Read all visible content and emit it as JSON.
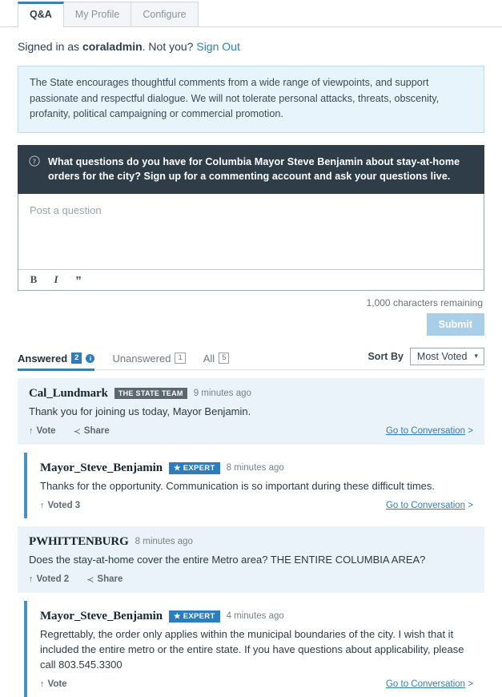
{
  "tabs": [
    {
      "label": "Q&A",
      "active": true
    },
    {
      "label": "My Profile",
      "active": false
    },
    {
      "label": "Configure",
      "active": false
    }
  ],
  "account": {
    "prefix": "Signed in as ",
    "username": "coraladmin",
    "middle": ". Not you? ",
    "signout_label": "Sign Out"
  },
  "notice": {
    "text": "The State encourages thoughtful comments from a wide range of viewpoints, and support passionate and respectful dialogue. We will not tolerate personal attacks, threats, obscenity, profanity, political campaigning or commercial promotion."
  },
  "question_banner": {
    "icon": "question-circle-icon",
    "text": "What questions do you have for Columbia Mayor Steve Benjamin about stay-at-home orders for the city? Sign up for a commenting account and ask your questions live."
  },
  "composer": {
    "placeholder": "Post a question",
    "value": "",
    "toolbar": [
      {
        "name": "bold-icon",
        "glyph": "B"
      },
      {
        "name": "italic-icon",
        "glyph": "I"
      },
      {
        "name": "blockquote-icon",
        "glyph": "”"
      }
    ],
    "characters_remaining": "1,000 characters remaining",
    "submit_label": "Submit"
  },
  "filters": [
    {
      "label": "Answered",
      "count": "2",
      "active": true,
      "style": "filled",
      "info_icon": "info-circle-icon"
    },
    {
      "label": "Unanswered",
      "count": "1",
      "active": false,
      "style": "outline"
    },
    {
      "label": "All",
      "count": "5",
      "active": false,
      "style": "outline"
    }
  ],
  "sort": {
    "label": "Sort By",
    "value": "Most Voted",
    "caret": "chevron-down-icon"
  },
  "comments": [
    {
      "author": "Cal_Lundmark",
      "badge": "THE STATE TEAM",
      "badge_type": "team",
      "time": "9 minutes ago",
      "body": "Thank you for joining us today, Mayor Benjamin.",
      "reply": false,
      "vote_label": "Vote",
      "share_label": "Share",
      "goto_label": "Go to Conversation"
    },
    {
      "author": "Mayor_Steve_Benjamin",
      "badge": "★ EXPERT",
      "badge_type": "expert",
      "time": "8 minutes ago",
      "body": "Thanks for the opportunity.  Communication is so important during these difficult times.",
      "reply": true,
      "vote_label": "Voted 3",
      "share_label": "",
      "goto_label": "Go to Conversation"
    },
    {
      "author": "PWHITTENBURG",
      "badge": "",
      "badge_type": "none",
      "time": "8 minutes ago",
      "body": "Does the stay-at-home cover the entire Metro area? THE ENTIRE COLUMBIA AREA?",
      "reply": false,
      "vote_label": "Voted 2",
      "share_label": "Share",
      "goto_label": ""
    },
    {
      "author": "Mayor_Steve_Benjamin",
      "badge": "★ EXPERT",
      "badge_type": "expert",
      "time": "4 minutes ago",
      "body": "Regrettably, the order only applies within the municipal boundaries of the city.  I wish that it included the entire metro or the entire state. If you have questions about applicability, please call 803.545.3300",
      "reply": true,
      "vote_label": "Vote",
      "share_label": "",
      "goto_label": "Go to Conversation"
    }
  ],
  "colors": {
    "accent_blue": "#2d7dbd",
    "tab_underline": "#3b80b3",
    "banner_dark": "#2f3d49",
    "notice_bg": "#e8f4fb",
    "comment_bg": "#e9f3f9",
    "badge_team": "#5b6870",
    "submit_disabled": "#a9cfe8"
  }
}
